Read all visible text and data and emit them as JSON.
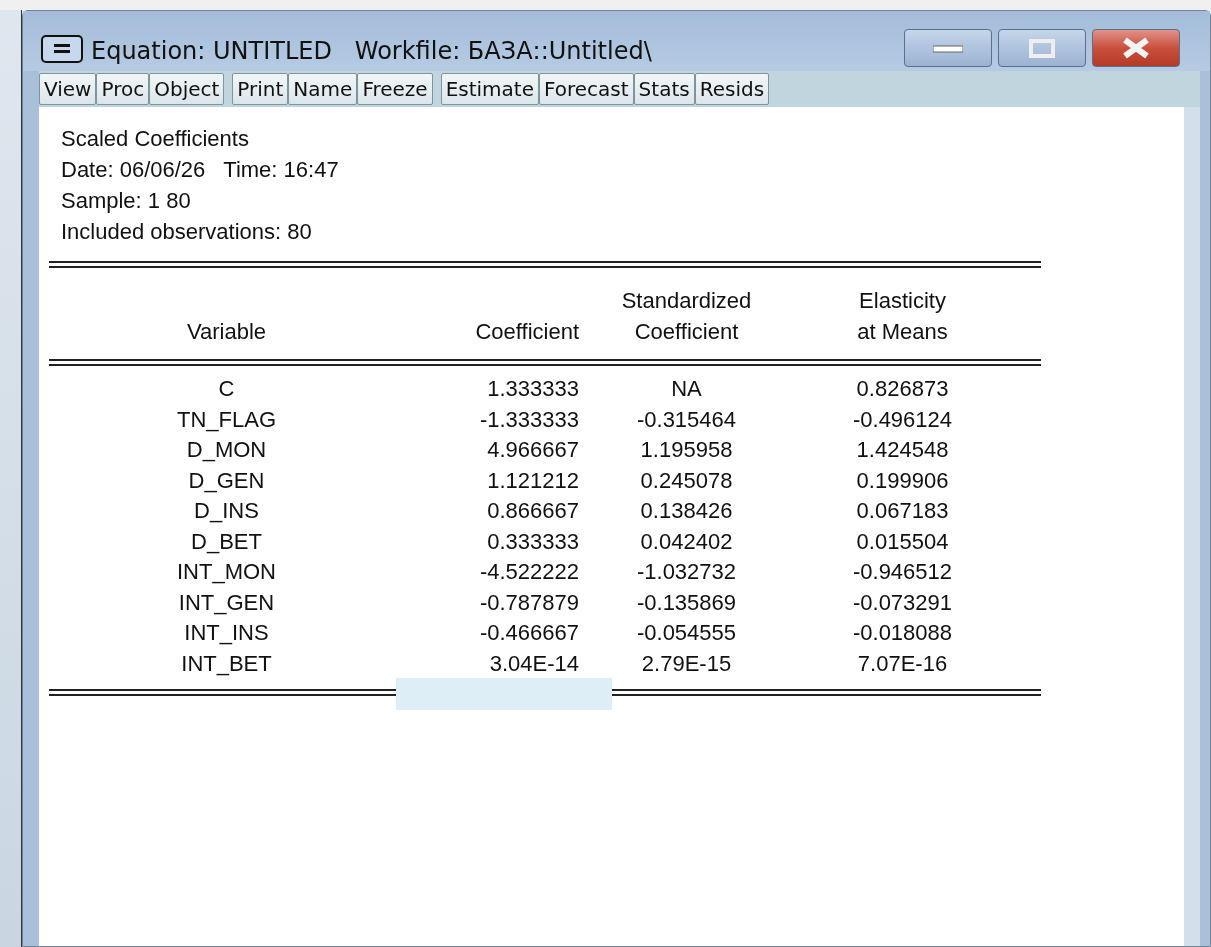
{
  "window": {
    "title": "Equation: UNTITLED   Workfile: БАЗА::Untitled\\"
  },
  "toolbar": {
    "groups": [
      [
        "View",
        "Proc",
        "Object"
      ],
      [
        "Print",
        "Name",
        "Freeze"
      ],
      [
        "Estimate",
        "Forecast",
        "Stats",
        "Resids"
      ]
    ]
  },
  "header": [
    "Scaled Coefficients",
    "Date: 06/06/26   Time: 16:47",
    "Sample: 1 80",
    "Included observations: 80"
  ],
  "table": {
    "columns": [
      "Variable",
      "Coefficient",
      "Standardized\nCoefficient",
      "Elasticity\nat Means"
    ],
    "rows": [
      [
        "C",
        "1.333333",
        "NA",
        "0.826873"
      ],
      [
        "TN_FLAG",
        "-1.333333",
        "-0.315464",
        "-0.496124"
      ],
      [
        "D_MON",
        "4.966667",
        "1.195958",
        "1.424548"
      ],
      [
        "D_GEN",
        "1.121212",
        "0.245078",
        "0.199906"
      ],
      [
        "D_INS",
        "0.866667",
        "0.138426",
        "0.067183"
      ],
      [
        "D_BET",
        "0.333333",
        "0.042402",
        "0.015504"
      ],
      [
        "INT_MON",
        "-4.522222",
        "-1.032732",
        "-0.946512"
      ],
      [
        "INT_GEN",
        "-0.787879",
        "-0.135869",
        "-0.073291"
      ],
      [
        "INT_INS",
        "-0.466667",
        "-0.054555",
        "-0.018088"
      ],
      [
        "INT_BET",
        "3.04E-14",
        "2.79E-15",
        "7.07E-16"
      ]
    ]
  }
}
